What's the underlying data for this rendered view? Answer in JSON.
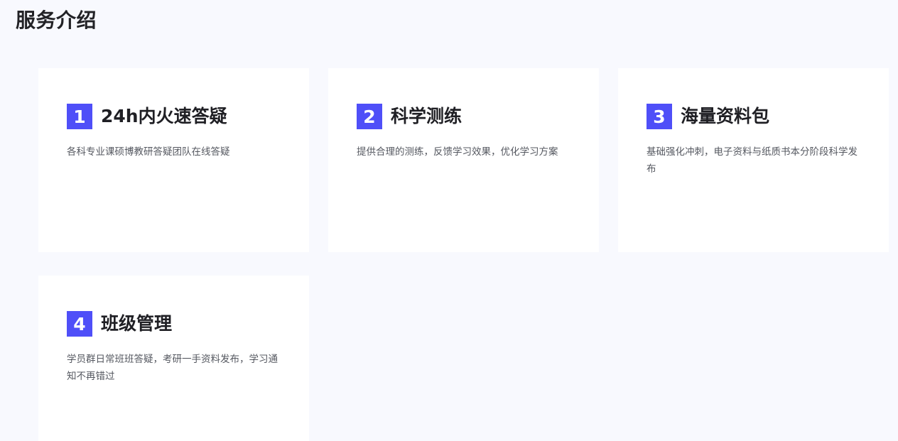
{
  "section": {
    "title": "服务介绍"
  },
  "cards": [
    {
      "number": "1",
      "title": "24h内火速答疑",
      "description": "各科专业课硕博教研答疑团队在线答疑"
    },
    {
      "number": "2",
      "title": "科学测练",
      "description": "提供合理的测练，反馈学习效果，优化学习方案"
    },
    {
      "number": "3",
      "title": "海量资料包",
      "description": "基础强化冲刺，电子资料与纸质书本分阶段科学发布"
    },
    {
      "number": "4",
      "title": "班级管理",
      "description": "学员群日常班班答疑，考研一手资料发布，学习通知不再错过"
    }
  ],
  "colors": {
    "accent": "#4f4ff8",
    "background": "#f8f9fe",
    "card": "#ffffff"
  }
}
